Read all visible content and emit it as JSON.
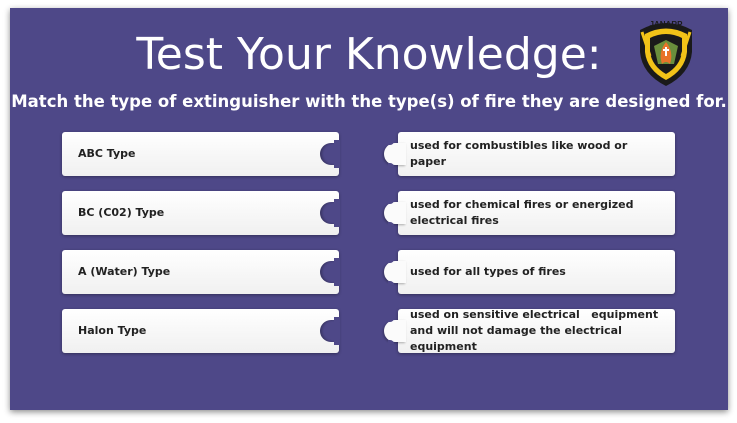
{
  "title": "Test Your Knowledge:",
  "subtitle": "Match the type of extinguisher with the type(s) of fire they are designed for.",
  "logo": {
    "text": "JANARP",
    "icon": "fire-shield-logo-icon",
    "colors": {
      "shield": "#1a1a1a",
      "stripe": "#f2c318",
      "flame": "#e8742a",
      "cross": "#6a8f3c"
    }
  },
  "colors": {
    "background": "#4e4888",
    "card": "#ffffff",
    "text": "#222222"
  },
  "pairs": [
    {
      "left": "ABC Type",
      "right": "used for combustibles like wood or paper"
    },
    {
      "left": "BC (C02) Type",
      "right": "used for chemical fires or energized electrical fires"
    },
    {
      "left": "A (Water) Type",
      "right": "used for all types of fires"
    },
    {
      "left": "Halon Type",
      "right": "used on sensitive electrical   equipment and will not damage the electrical equipment"
    }
  ]
}
